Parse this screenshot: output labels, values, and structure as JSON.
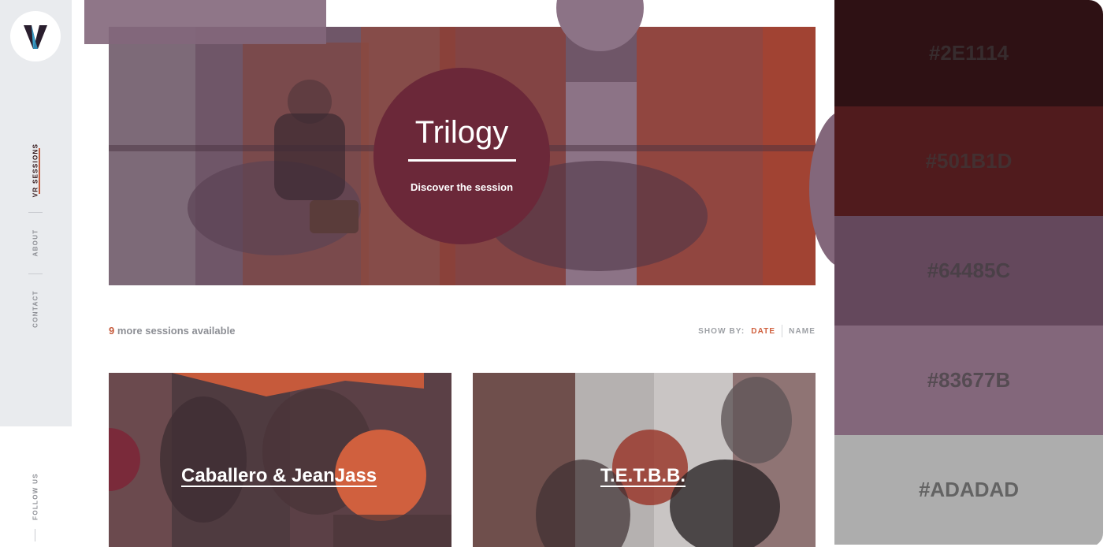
{
  "sidebar": {
    "logo_letter": "V",
    "nav": [
      {
        "label": "VR SESSIONS"
      },
      {
        "label": "ABOUT"
      },
      {
        "label": "CONTACT"
      }
    ],
    "follow_label": "FOLLOW US"
  },
  "hero": {
    "title": "Trilogy",
    "subtitle": "Discover the session"
  },
  "list": {
    "count_number": "9",
    "count_text": " more sessions available",
    "showby_label": "SHOW BY:",
    "sort_date": "DATE",
    "sort_name": "NAME"
  },
  "cards": [
    {
      "title": "Caballero & JeanJass"
    },
    {
      "title": "T.E.T.B.B."
    }
  ],
  "palette": [
    {
      "hex": "#2E1114",
      "label": "#2E1114"
    },
    {
      "hex": "#501B1D",
      "label": "#501B1D"
    },
    {
      "hex": "#64485C",
      "label": "#64485C"
    },
    {
      "hex": "#83677B",
      "label": "#83677B"
    },
    {
      "hex": "#ADADAD",
      "label": "#ADADAD"
    }
  ],
  "colors": {
    "accent": "#c65a3b",
    "hero_circle": "#6b2839",
    "logo_blue": "#3b9fc8"
  }
}
